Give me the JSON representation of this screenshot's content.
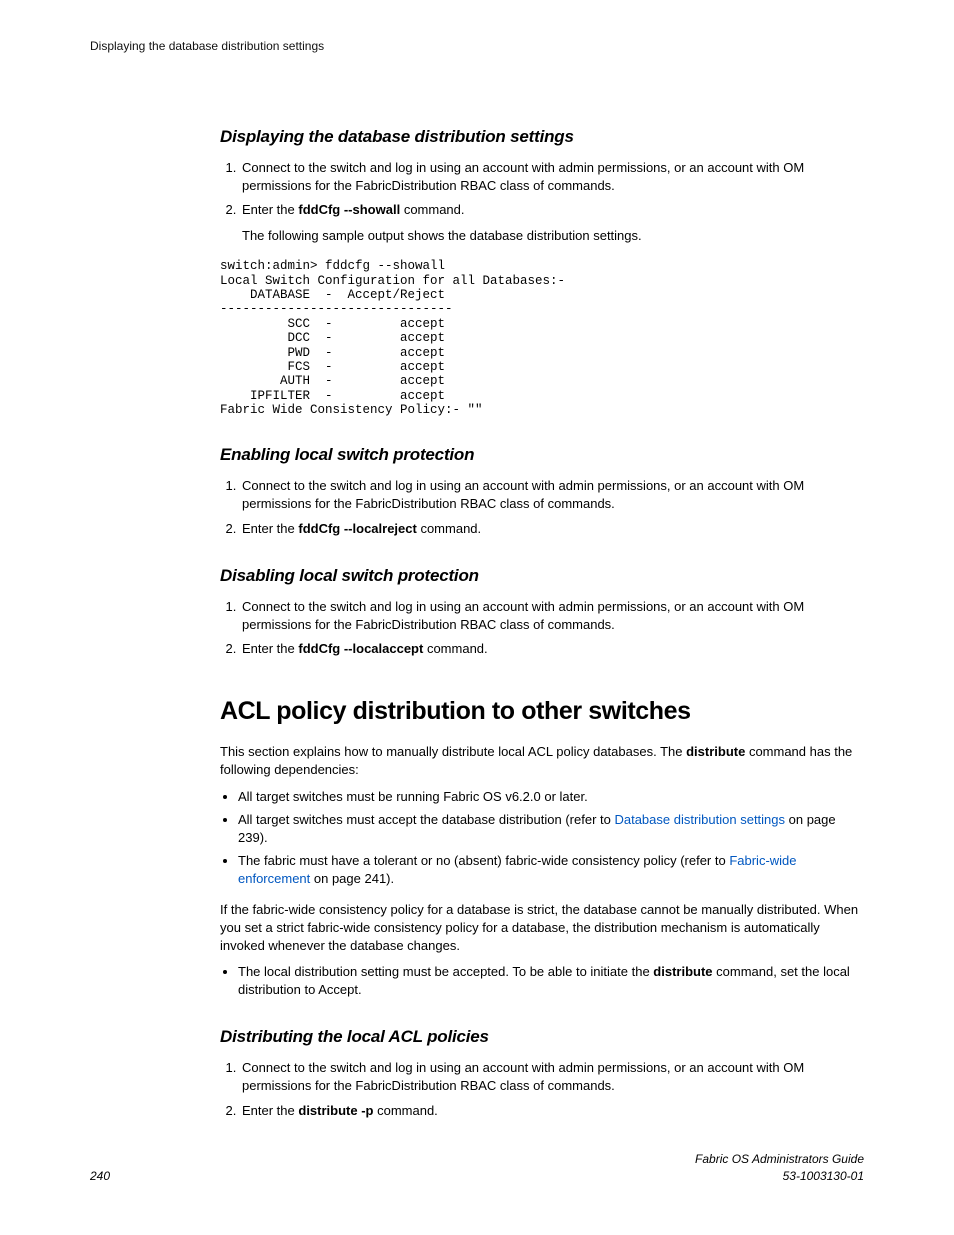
{
  "runningHead": "Displaying the database distribution settings",
  "sec1": {
    "title": "Displaying the database distribution settings",
    "step1": "Connect to the switch and log in using an account with admin permissions, or an account with OM permissions for the FabricDistribution RBAC class of commands.",
    "step2_pre": "Enter the ",
    "step2_cmd": "fddCfg --showall",
    "step2_post": " command.",
    "step2_note": "The following sample output shows the database distribution settings.",
    "code": "switch:admin> fddcfg --showall\nLocal Switch Configuration for all Databases:-\n    DATABASE  -  Accept/Reject\n-------------------------------\n         SCC  -         accept\n         DCC  -         accept\n         PWD  -         accept\n         FCS  -         accept\n        AUTH  -         accept\n    IPFILTER  -         accept\nFabric Wide Consistency Policy:- \"\""
  },
  "sec2": {
    "title": "Enabling local switch protection",
    "step1": "Connect to the switch and log in using an account with admin permissions, or an account with OM permissions for the FabricDistribution RBAC class of commands.",
    "step2_pre": "Enter the ",
    "step2_cmd": "fddCfg --localreject",
    "step2_post": " command."
  },
  "sec3": {
    "title": "Disabling local switch protection",
    "step1": "Connect to the switch and log in using an account with admin permissions, or an account with OM permissions for the FabricDistribution RBAC class of commands.",
    "step2_pre": "Enter the ",
    "step2_cmd": "fddCfg --localaccept",
    "step2_post": " command."
  },
  "sec4": {
    "title": "ACL policy distribution to other switches",
    "intro_pre": "This section explains how to manually distribute local ACL policy databases. The ",
    "intro_cmd": "distribute",
    "intro_post": " command has the following dependencies:",
    "bul1": "All target switches must be running Fabric OS v6.2.0 or later.",
    "bul2_pre": "All target switches must accept the database distribution (refer to ",
    "bul2_link": "Database distribution settings",
    "bul2_post": " on page 239).",
    "bul3_pre": "The fabric must have a tolerant or no (absent) fabric-wide consistency policy (refer to ",
    "bul3_link": "Fabric-wide enforcement",
    "bul3_post": " on page 241).",
    "para2": "If the fabric-wide consistency policy for a database is strict, the database cannot be manually distributed. When you set a strict fabric-wide consistency policy for a database, the distribution mechanism is automatically invoked whenever the database changes.",
    "bul4_pre": "The local distribution setting must be accepted. To be able to initiate the ",
    "bul4_cmd": "distribute",
    "bul4_post": " command, set the local distribution to Accept."
  },
  "sec5": {
    "title": "Distributing the local ACL policies",
    "step1": "Connect to the switch and log in using an account with admin permissions, or an account with OM permissions for the FabricDistribution RBAC class of commands.",
    "step2_pre": "Enter the ",
    "step2_cmd": "distribute -p",
    "step2_post": " command."
  },
  "footer": {
    "pageNum": "240",
    "bookTitle": "Fabric OS Administrators Guide",
    "docNum": "53-1003130-01"
  }
}
